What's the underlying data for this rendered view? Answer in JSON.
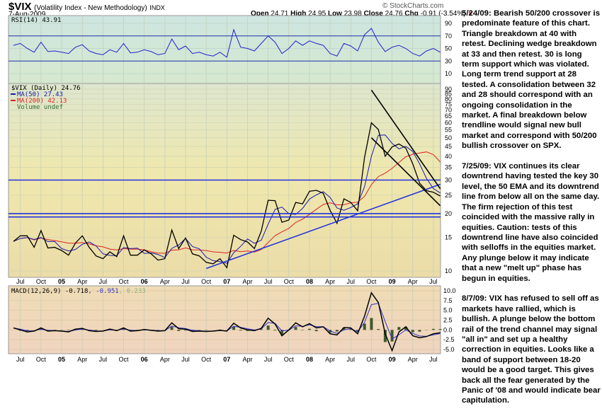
{
  "header": {
    "symbol": "$VIX",
    "name": "(Volatility Index - New Methodology)",
    "exchange": "INDX",
    "date": "7-Aug-2009",
    "brand": "© StockCharts.com",
    "open_label": "Open",
    "open": "24.71",
    "high_label": "High",
    "high": "24.95",
    "low_label": "Low",
    "low": "23.98",
    "close_label": "Close",
    "close": "24.76",
    "chg_label": "Chg",
    "chg": "-0.91 (-3.54%)",
    "chg_icon": "down-triangle-icon"
  },
  "colors": {
    "price": "#000000",
    "ma50": "#1a1aaa",
    "ma200": "#dd2222",
    "volume": "#336633",
    "rsi": "#2222cc",
    "macd": "#000000",
    "signal": "#3333cc",
    "hist": "#3d5a2e",
    "trend": "#2233dd",
    "wedge": "#000000"
  },
  "notes": [
    "5/24/09:  Bearish 50/200 crossover is predominate feature of this chart.  Triangle breakdown at 40 with retest.  Declining wedge breakdown at 33 and then retest.  30 is long term support which was violated.   Long term trend support at 28 tested.  A consolidation between 32 and 28 should correspond with an ongoing consolidation in the market.  A final breakdown below trendline would signal new bull market and correspond with 50/200 bullish crossover on SPX.",
    "7/25/09:  VIX continues its clear downtrend having tested the key 30 level, the 50 EMA and its downtrend line from below all on the same day.  The firm rejection of this test coincided with the massive rally in equities.  Caution:  tests of this downtrend line have also coincided with selloffs in the equities market.  Any plunge below it may indicate that a new \"melt up\" phase has begun in equities.",
    "8/7/09:  VIX has refused to sell off as markets have rallied, which is bullish.  A plunge below the bottom rail of the trend channel may signal \"all in\" and set up a healthy correction in equities.  Looks like a band of support between 18-20 would be a good target.   This gives back all the fear generated by the Panic of '08 and would indicate bear capitulation."
  ],
  "chart_data": [
    {
      "type": "line",
      "panel": "rsi",
      "legend": "RSI(14) 43.91",
      "yticks": [
        10,
        30,
        50,
        70,
        90
      ],
      "ylim": [
        0,
        100
      ],
      "reference_lines": [
        30,
        70
      ],
      "start_month": "2004-06",
      "values": [
        55,
        58,
        50,
        44,
        60,
        45,
        46,
        44,
        42,
        52,
        56,
        46,
        42,
        40,
        48,
        44,
        58,
        43,
        44,
        48,
        45,
        40,
        42,
        65,
        48,
        54,
        42,
        44,
        40,
        38,
        44,
        36,
        80,
        52,
        50,
        46,
        58,
        70,
        60,
        42,
        50,
        62,
        55,
        62,
        58,
        55,
        42,
        38,
        58,
        54,
        46,
        72,
        82,
        60,
        45,
        52,
        55,
        50,
        42,
        38,
        46,
        50,
        44
      ]
    },
    {
      "type": "line",
      "panel": "price",
      "scale": "log",
      "legend": {
        "price": "$VIX (Daily) 24.76",
        "ma50": "MA(50) 27.43",
        "ma200": "MA(200) 42.13",
        "volume": "Volume undef"
      },
      "yticks": [
        10,
        15,
        20,
        25,
        30,
        35,
        40,
        45,
        50,
        55,
        60,
        65,
        70,
        75,
        80,
        85,
        90
      ],
      "ylim": [
        9.5,
        92
      ],
      "xticks": [
        "Jul",
        "Oct",
        "05",
        "Apr",
        "Jul",
        "Oct",
        "06",
        "Apr",
        "Jul",
        "Oct",
        "07",
        "Apr",
        "Jul",
        "Oct",
        "08",
        "Apr",
        "Jul",
        "Oct",
        "09",
        "Apr",
        "Jul"
      ],
      "xtick_months": [
        "2004-07",
        "2004-10",
        "2005-01",
        "2005-04",
        "2005-07",
        "2005-10",
        "2006-01",
        "2006-04",
        "2006-07",
        "2006-10",
        "2007-01",
        "2007-04",
        "2007-07",
        "2007-10",
        "2008-01",
        "2008-04",
        "2008-07",
        "2008-10",
        "2009-01",
        "2009-04",
        "2009-07"
      ],
      "start_month": "2004-06",
      "close": [
        14.3,
        15.3,
        15.3,
        13.3,
        16.3,
        13.2,
        13.3,
        12.8,
        12.1,
        14.0,
        15.3,
        13.3,
        12.0,
        11.6,
        12.6,
        11.9,
        15.3,
        12.1,
        12.1,
        12.9,
        12.3,
        11.4,
        11.6,
        16.4,
        13.1,
        14.9,
        12.3,
        12.0,
        11.1,
        10.9,
        11.6,
        10.4,
        15.4,
        14.6,
        14.2,
        13.1,
        16.2,
        23.5,
        23.4,
        18.0,
        18.5,
        22.9,
        22.5,
        26.2,
        26.5,
        25.6,
        20.8,
        17.8,
        23.9,
        22.9,
        20.7,
        39.4,
        59.9,
        55.3,
        40.0,
        44.8,
        46.4,
        44.1,
        36.5,
        28.9,
        26.4,
        25.9,
        24.76
      ],
      "annotations": [
        {
          "type": "hline",
          "value": 30,
          "color": "trend"
        },
        {
          "type": "hline",
          "value": 20,
          "color": "trend"
        },
        {
          "type": "hline",
          "value": 19.2,
          "color": "trend"
        },
        {
          "type": "trendline",
          "from": [
            "2006-10",
            10.3
          ],
          "to": [
            "2009-08",
            28.5
          ],
          "color": "trend"
        },
        {
          "type": "trendline",
          "from": [
            "2008-10",
            89
          ],
          "to": [
            "2009-08",
            27
          ],
          "color": "wedge"
        },
        {
          "type": "trendline",
          "from": [
            "2008-10",
            50
          ],
          "to": [
            "2009-08",
            22
          ],
          "color": "wedge"
        }
      ]
    },
    {
      "type": "line",
      "panel": "macd",
      "legend": {
        "name": "MACD(12,26,9)",
        "macd": "-0.718",
        "signal": ", -0.951",
        "hist": ", 0.233"
      },
      "yticks": [
        "10.0",
        "7.5",
        "5.0",
        "2.5",
        "0.0",
        "-2.5",
        "-5.0"
      ],
      "ylim": [
        -6,
        11
      ],
      "start_month": "2004-06",
      "macd": [
        0.5,
        0,
        -0.5,
        -0.3,
        0.5,
        -0.3,
        -0.2,
        -0.3,
        -0.5,
        0.2,
        0.4,
        -0.2,
        -0.4,
        -0.3,
        0.2,
        -0.2,
        0.5,
        -0.3,
        -0.2,
        0.1,
        -0.1,
        -0.3,
        -0.2,
        1.8,
        0.3,
        0.2,
        -0.4,
        -0.3,
        -0.4,
        -0.3,
        -0.1,
        -0.3,
        1.7,
        0.5,
        0,
        -0.2,
        0.4,
        3.0,
        1.5,
        -1.5,
        0,
        1.8,
        0.8,
        1.6,
        0.5,
        0.8,
        -1.0,
        -1.3,
        0.6,
        0.5,
        -1.0,
        3.5,
        9.5,
        7.0,
        -1.0,
        -5.3,
        -0.5,
        0.8,
        -1.5,
        -2.0,
        -1.7,
        -1.0,
        -0.718
      ]
    }
  ]
}
